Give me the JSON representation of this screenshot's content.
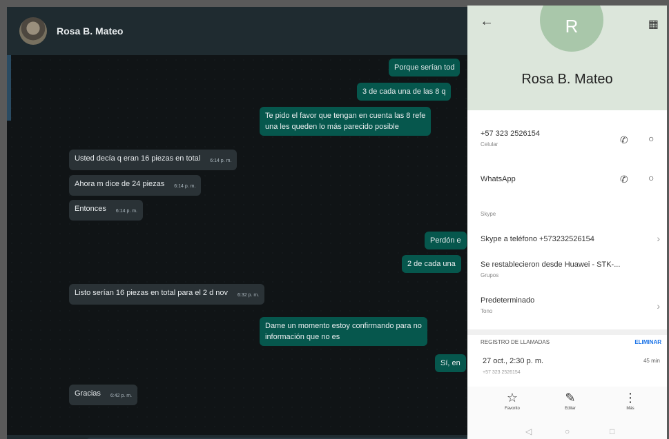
{
  "chat": {
    "contact_name": "Rosa B. Mateo",
    "messages": [
      {
        "dir": "out",
        "lines": [
          "Porque serían tod"
        ],
        "time": ""
      },
      {
        "dir": "out",
        "lines": [
          "3 de cada una de las 8 q"
        ],
        "time": ""
      },
      {
        "dir": "out",
        "lines": [
          "Te pido el favor que tengan en cuenta las 8 refe",
          "una les queden lo más parecido posible"
        ],
        "time": ""
      },
      {
        "dir": "in",
        "lines": [
          "Usted decía   q eran 16 piezas en total"
        ],
        "time": "6:14 p. m."
      },
      {
        "dir": "in",
        "lines": [
          "Ahora m dice de 24 piezas"
        ],
        "time": "6:14 p. m."
      },
      {
        "dir": "in",
        "lines": [
          "Entonces"
        ],
        "time": "6:14 p. m."
      },
      {
        "dir": "out",
        "lines": [
          "Perdón e"
        ],
        "time": ""
      },
      {
        "dir": "out",
        "lines": [
          "2 de cada una"
        ],
        "time": ""
      },
      {
        "dir": "in",
        "lines": [
          "Listo serían 16 piezas en total para el 2 d nov"
        ],
        "time": "6:32 p. m."
      },
      {
        "dir": "out",
        "lines": [
          "Dame un momento estoy confirmando para no",
          "información que no es"
        ],
        "time": ""
      },
      {
        "dir": "out",
        "lines": [
          "Sí, en"
        ],
        "time": ""
      },
      {
        "dir": "in",
        "lines": [
          "Gracias"
        ],
        "time": "6:42 p. m."
      }
    ]
  },
  "contact": {
    "avatar_letter": "R",
    "name": "Rosa B. Mateo",
    "phone_number": "+57 323 2526154",
    "phone_type": "Celular",
    "whatsapp_label": "WhatsApp",
    "skype_section": "Skype",
    "skype_call": "Skype a teléfono +573232526154",
    "restored_text": "Se restablecieron desde Huawei - STK-...",
    "restored_sub": "Grupos",
    "ringtone_label": "Predeterminado",
    "ringtone_sub": "Tono",
    "call_log_title": "REGISTRO DE LLAMADAS",
    "call_log_action": "ELIMINAR",
    "call_date": "27 oct., 2:30 p. m.",
    "call_duration": "45 min",
    "call_number": "+57 323 2526154",
    "nav": {
      "favorite": "Favorito",
      "edit": "Editar",
      "more": "Más"
    }
  },
  "icons": {
    "back": "arrow-left-icon",
    "qr": "qr-code-icon",
    "call": "phone-icon",
    "message": "chat-bubble-icon",
    "chevron": "chevron-right-icon",
    "star": "star-icon",
    "pencil": "pencil-icon",
    "more": "more-vertical-icon"
  },
  "colors": {
    "chat_bg": "#101416",
    "outgoing_bubble": "#06574d",
    "incoming_bubble": "#2a3236",
    "accent_link": "#1a73e8",
    "contact_header": "#dce6db"
  }
}
